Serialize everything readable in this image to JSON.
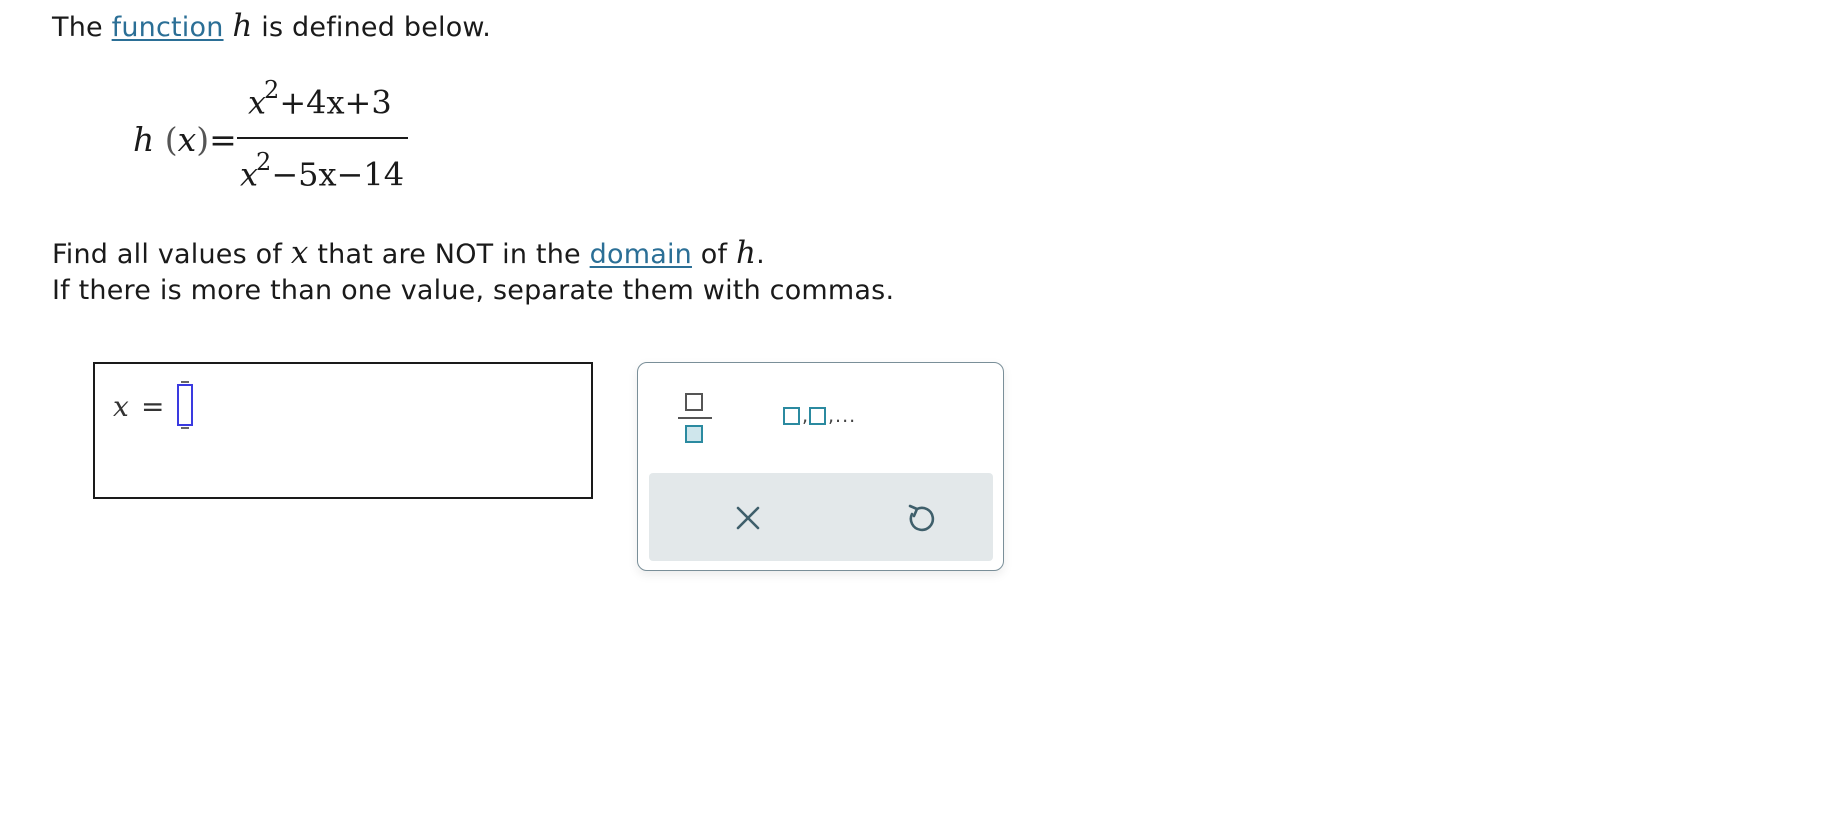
{
  "question": {
    "line1": {
      "pre": "The",
      "link": "function",
      "var": "h",
      "post": "is defined below."
    },
    "formula": {
      "lhs_func": "h",
      "lhs_var": "x",
      "equals": "=",
      "numerator": {
        "base": "x",
        "exp": "2",
        "rest": "+4x+3"
      },
      "denominator": {
        "base": "x",
        "exp": "2",
        "rest": "−5x−14"
      }
    },
    "line2": {
      "pre": "Find all values of",
      "var": "x",
      "mid": "that are NOT in the",
      "link": "domain",
      "post_of": "of",
      "var2": "h",
      "period": "."
    },
    "line3": "If there is more than one value, separate them with commas."
  },
  "answer": {
    "var": "x",
    "equals": "=",
    "value": ""
  },
  "toolbar": {
    "fraction_icon": "fraction-template-icon",
    "list_icon": "comma-list-template-icon",
    "list_sep": ",",
    "list_more": ",...",
    "clear_icon": "close-icon",
    "undo_icon": "undo-icon"
  },
  "colors": {
    "link": "#2b6f96",
    "accent": "#2b8aa0",
    "cursor": "#3a3ae0",
    "action_bar": "#e3e8ea",
    "panel_border": "#7a8f99"
  }
}
